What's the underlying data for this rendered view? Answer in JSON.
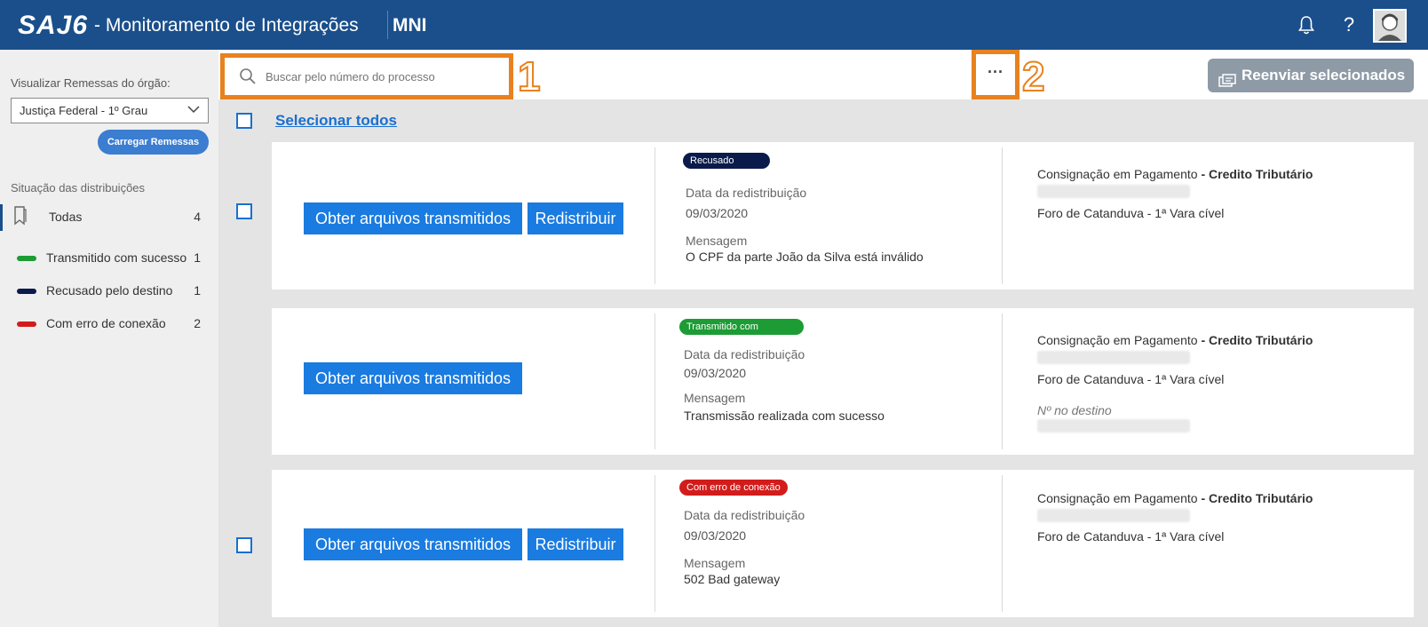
{
  "header": {
    "logo": "SAJ6",
    "app_title": "- Monitoramento de Integrações",
    "module": "MNI",
    "help_glyph": "?"
  },
  "sidebar": {
    "org_label": "Visualizar Remessas do órgão:",
    "org_selected": "Justiça Federal - 1º Grau",
    "load_button": "Carregar Remessas",
    "section_title": "Situação das distribuições",
    "filters": [
      {
        "label": "Todas",
        "count": "4"
      },
      {
        "label": "Transmitido com sucesso",
        "count": "1",
        "color": "#1d9b35"
      },
      {
        "label": "Recusado pelo destino",
        "count": "1",
        "color": "#0a1a4a"
      },
      {
        "label": "Com erro de conexão",
        "count": "2",
        "color": "#d21c1c"
      }
    ]
  },
  "toolbar": {
    "search_placeholder": "Buscar pelo número do processo",
    "callout_1": "1",
    "more_label": "···",
    "callout_2": "2",
    "resend_button": "Reenviar selecionados"
  },
  "list": {
    "select_all": "Selecionar todos",
    "items": [
      {
        "buttons": [
          "Obter arquivos transmitidos",
          "Redistribuir"
        ],
        "status": "Recusado",
        "status_color": "#0a1a4a",
        "date_label": "Data da redistribuição",
        "date": "09/03/2020",
        "message_label": "Mensagem",
        "message": "O CPF da parte João da Silva está inválido",
        "class_text": "Consignação em Pagamento",
        "subject": "- Credito Tributário",
        "court": "Foro de Catanduva - 1ª Vara cível"
      },
      {
        "buttons": [
          "Obter arquivos transmitidos"
        ],
        "status": "Transmitido com sucesso",
        "status_color": "#1d9b35",
        "date_label": "Data da redistribuição",
        "date": "09/03/2020",
        "message_label": "Mensagem",
        "message": "Transmissão realizada com sucesso",
        "class_text": "Consignação em Pagamento",
        "subject": "- Credito Tributário",
        "court": "Foro de Catanduva - 1ª Vara cível",
        "dest_label": "Nº no destino"
      },
      {
        "buttons": [
          "Obter arquivos transmitidos",
          "Redistribuir"
        ],
        "status": "Com erro de conexão",
        "status_color": "#d21c1c",
        "date_label": "Data da redistribuição",
        "date": "09/03/2020",
        "message_label": "Mensagem",
        "message": "502 Bad gateway",
        "class_text": "Consignação em Pagamento",
        "subject": "- Credito Tributário",
        "court": "Foro de Catanduva - 1ª Vara cível"
      }
    ]
  }
}
